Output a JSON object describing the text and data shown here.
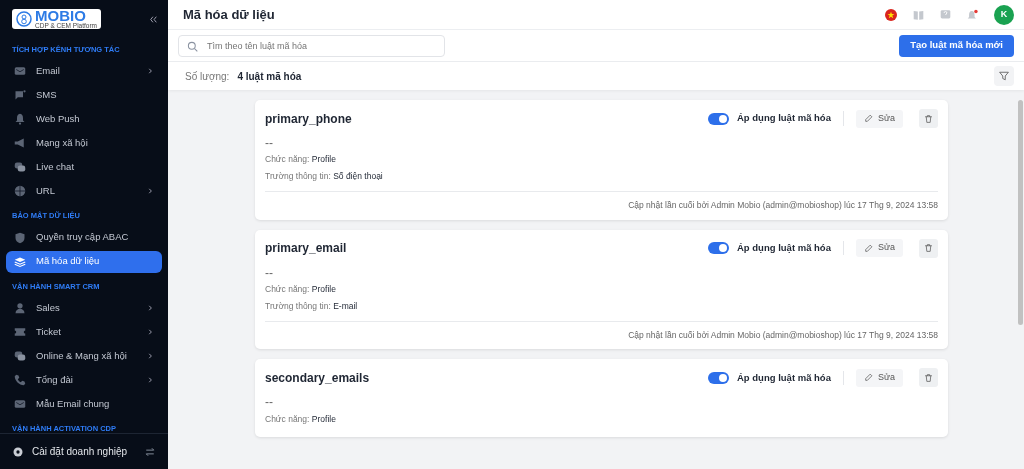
{
  "logo": {
    "name": "MOBIO",
    "tagline": "CDP & CEM Platform"
  },
  "sidebar": {
    "sections": [
      {
        "heading": "TÍCH HỢP KÊNH TƯƠNG TÁC",
        "items": [
          {
            "label": "Email",
            "has_children": true,
            "selected": false
          },
          {
            "label": "SMS",
            "has_children": false,
            "selected": false
          },
          {
            "label": "Web Push",
            "has_children": false,
            "selected": false
          },
          {
            "label": "Mạng xã hội",
            "has_children": false,
            "selected": false
          },
          {
            "label": "Live chat",
            "has_children": false,
            "selected": false
          },
          {
            "label": "URL",
            "has_children": true,
            "selected": false
          }
        ]
      },
      {
        "heading": "BẢO MẬT DỮ LIỆU",
        "items": [
          {
            "label": "Quyền truy cập ABAC",
            "has_children": false,
            "selected": false
          },
          {
            "label": "Mã hóa dữ liệu",
            "has_children": false,
            "selected": true
          }
        ]
      },
      {
        "heading": "VẬN HÀNH SMART CRM",
        "items": [
          {
            "label": "Sales",
            "has_children": true,
            "selected": false
          },
          {
            "label": "Ticket",
            "has_children": true,
            "selected": false
          },
          {
            "label": "Online & Mạng xã hội",
            "has_children": true,
            "selected": false
          },
          {
            "label": "Tổng đài",
            "has_children": true,
            "selected": false
          },
          {
            "label": "Mẫu Email chung",
            "has_children": false,
            "selected": false
          }
        ]
      },
      {
        "heading": "VẬN HÀNH ACTIVATION CDP"
      }
    ],
    "footer": "Cài đặt doanh nghiệp"
  },
  "header": {
    "title": "Mã hóa dữ liệu",
    "avatar": "K"
  },
  "search": {
    "placeholder": "Tìm theo tên luật mã hóa"
  },
  "create_button": "Tạo luật mã hóa mới",
  "count": {
    "label": "Số lượng:",
    "value": "4 luật mã hóa"
  },
  "rules": [
    {
      "name": "primary_phone",
      "applied": true,
      "toggle_label": "Áp dụng luật mã hóa",
      "edit": "Sửa",
      "description": "--",
      "function_label": "Chức năng:",
      "function": "Profile",
      "field_label": "Trường thông tin:",
      "field": "Số điện thoại",
      "updated": "Cập nhật lần cuối bởi Admin Mobio (admin@mobioshop) lúc 17 Thg 9, 2024 13:58"
    },
    {
      "name": "primary_email",
      "applied": true,
      "toggle_label": "Áp dụng luật mã hóa",
      "edit": "Sửa",
      "description": "--",
      "function_label": "Chức năng:",
      "function": "Profile",
      "field_label": "Trường thông tin:",
      "field": "E-mail",
      "updated": "Cập nhật lần cuối bởi Admin Mobio (admin@mobioshop) lúc 17 Thg 9, 2024 13:58"
    },
    {
      "name": "secondary_emails",
      "applied": true,
      "toggle_label": "Áp dụng luật mã hóa",
      "edit": "Sửa",
      "description": "--",
      "function_label": "Chức năng:",
      "function": "Profile"
    }
  ]
}
